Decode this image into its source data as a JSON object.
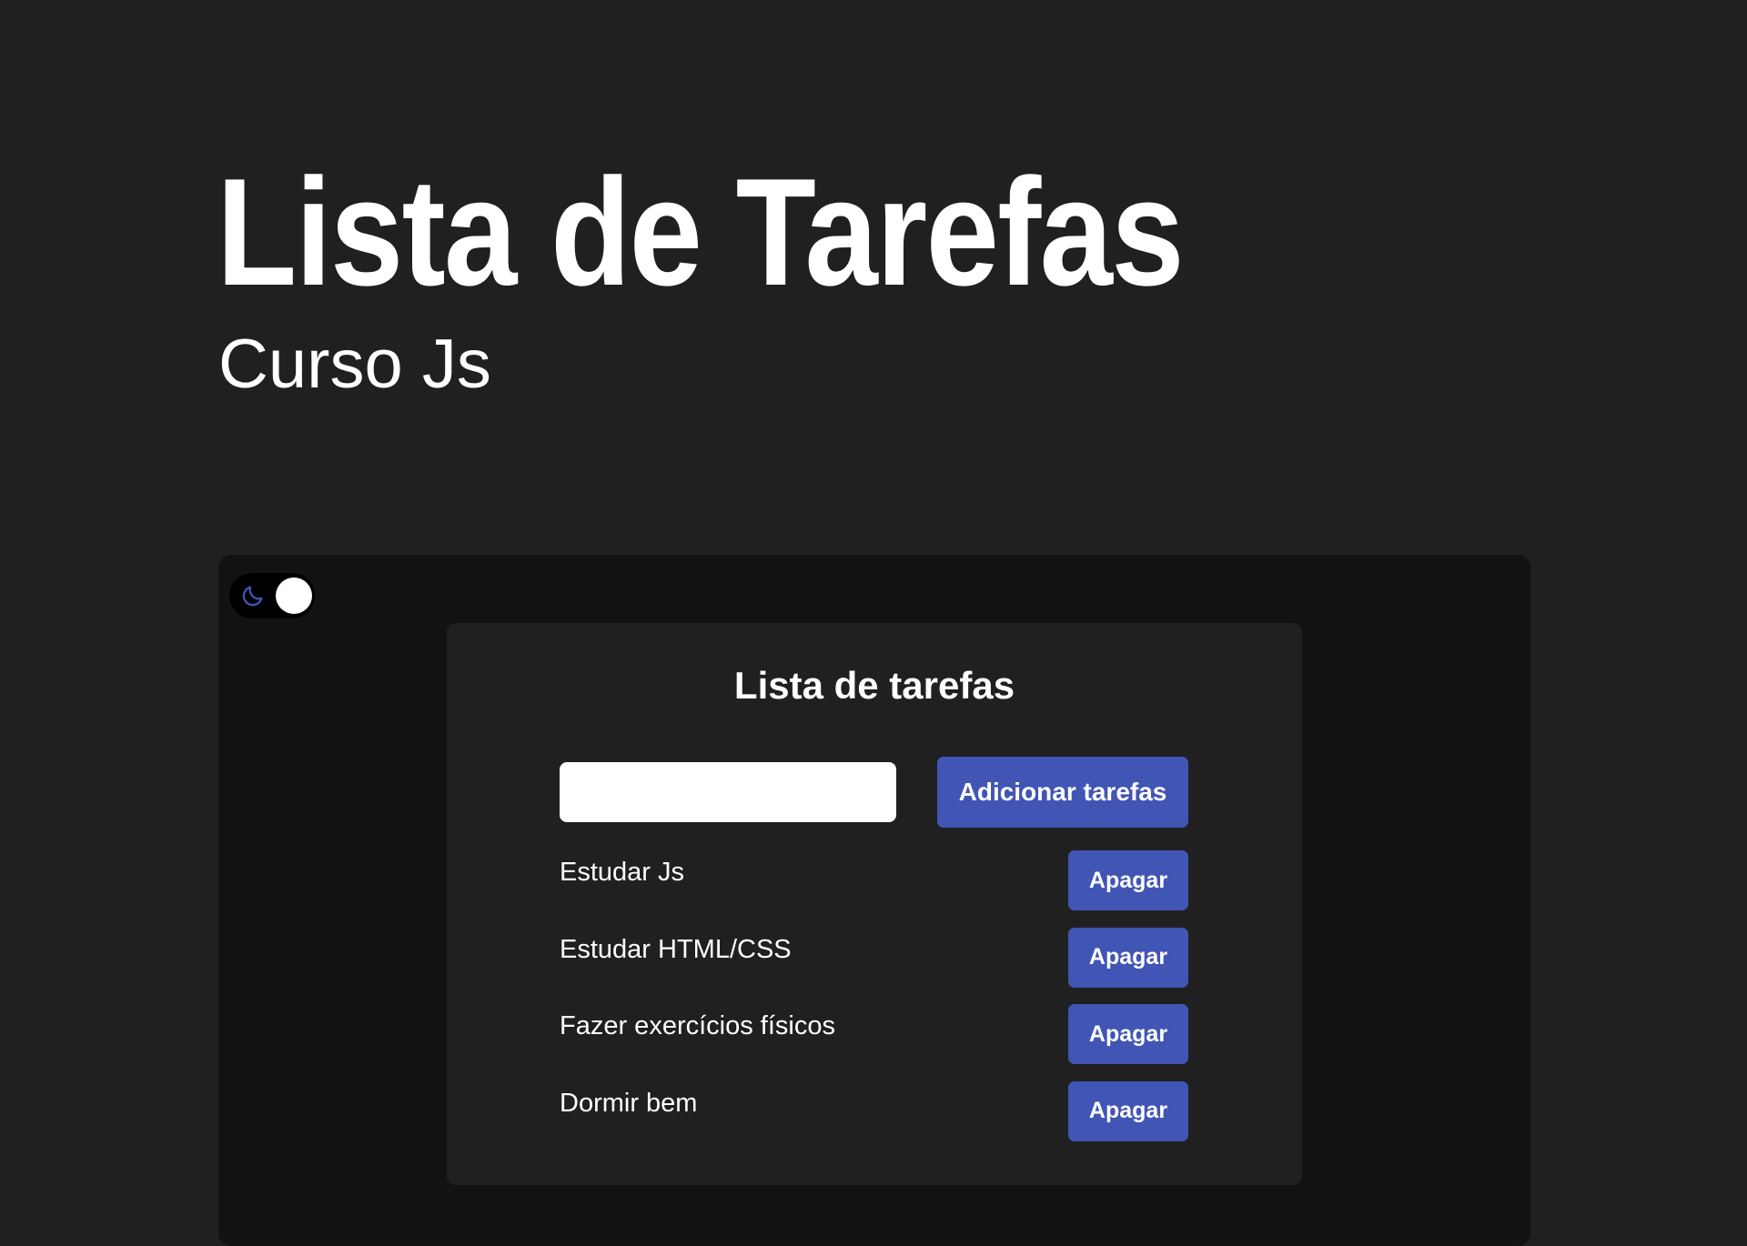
{
  "header": {
    "title": "Lista de Tarefas",
    "subtitle": "Curso Js"
  },
  "theme_toggle": {
    "icon": "moon-icon",
    "state": "dark"
  },
  "todo": {
    "heading": "Lista de tarefas",
    "input_value": "",
    "add_label": "Adicionar tarefas",
    "tasks": [
      {
        "text": "Estudar Js",
        "delete_label": "Apagar"
      },
      {
        "text": "Estudar HTML/CSS",
        "delete_label": "Apagar"
      },
      {
        "text": "Fazer exercícios físicos",
        "delete_label": "Apagar"
      },
      {
        "text": "Dormir bem",
        "delete_label": "Apagar"
      }
    ]
  },
  "colors": {
    "page_background": "#202020",
    "frame_background": "#121212",
    "card_background": "#202020",
    "accent": "#4155b5",
    "text": "#ffffff"
  }
}
